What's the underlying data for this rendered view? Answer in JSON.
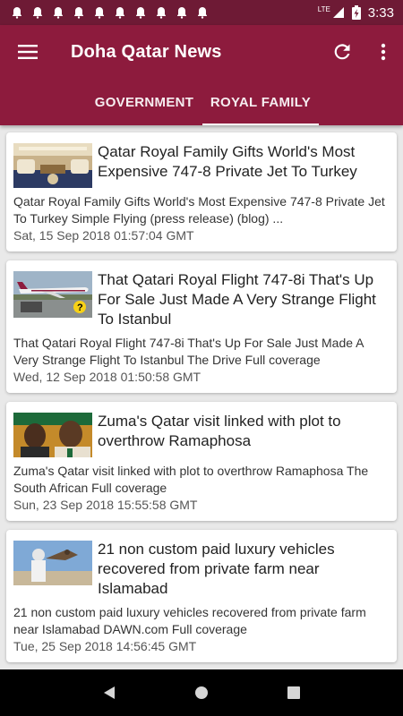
{
  "status_bar": {
    "time": "3:33",
    "network": "LTE",
    "notification_count": 10
  },
  "app": {
    "title": "Doha Qatar News"
  },
  "tabs": [
    {
      "label": "GOVERNMENT",
      "active": false
    },
    {
      "label": "ROYAL FAMILY",
      "active": true
    }
  ],
  "articles": [
    {
      "headline": "Qatar Royal Family Gifts World's Most Expensive 747-8 Private Jet To Turkey",
      "snippet": "Qatar Royal Family Gifts World's Most Expensive 747-8 Private Jet To Turkey  Simple Flying (press release) (blog)  ...",
      "date": "Sat, 15 Sep 2018 01:57:04 GMT",
      "thumb_icon": "jet-interior-image"
    },
    {
      "headline": "That Qatari Royal Flight 747-8i That's Up For Sale Just Made A Very Strange Flight To Istanbul",
      "snippet": "That Qatari Royal Flight 747-8i That's Up For Sale Just Made A Very Strange Flight To Istanbul  The Drive  Full coverage",
      "date": "Wed, 12 Sep 2018 01:50:58 GMT",
      "thumb_icon": "airplane-image"
    },
    {
      "headline": "Zuma's Qatar visit linked with plot to overthrow Ramaphosa",
      "snippet": "Zuma's Qatar visit linked with plot to overthrow Ramaphosa  The South African  Full coverage",
      "date": "Sun, 23 Sep 2018 15:55:58 GMT",
      "thumb_icon": "people-image"
    },
    {
      "headline": "21 non custom paid luxury vehicles recovered from private farm near Islamabad",
      "snippet": "21 non custom paid luxury vehicles recovered from private farm near Islamabad  DAWN.com  Full coverage",
      "date": "Tue, 25 Sep 2018 14:56:45 GMT",
      "thumb_icon": "falconer-image"
    }
  ],
  "colors": {
    "status_bar": "#6e1a35",
    "app_bar": "#8d1b3d",
    "background": "#e9e9e9"
  }
}
